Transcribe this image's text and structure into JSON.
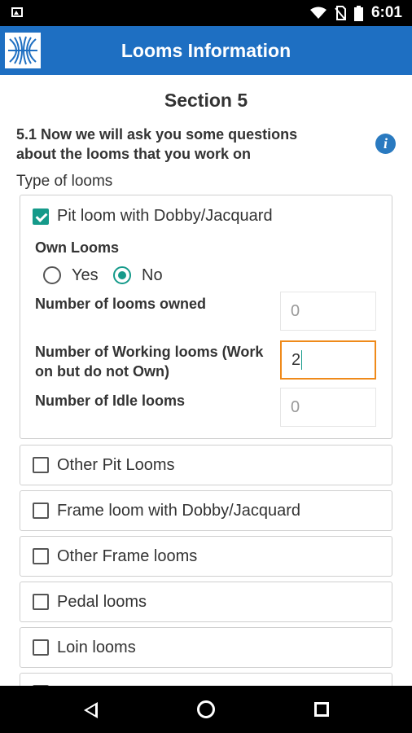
{
  "status_bar": {
    "time": "6:01"
  },
  "app_bar": {
    "title": "Looms Information"
  },
  "section": {
    "title": "Section 5",
    "question": "5.1 Now we will ask you some questions about the looms that you work on",
    "type_label": "Type of looms"
  },
  "looms": [
    {
      "label": "Pit loom with Dobby/Jacquard",
      "checked": true,
      "own_looms_label": "Own Looms",
      "own_options": [
        "Yes",
        "No"
      ],
      "own_selected": "No",
      "fields": [
        {
          "label": "Number of looms owned",
          "value": "0",
          "state": "disabled"
        },
        {
          "label": "Number of Working looms (Work on but do not Own)",
          "value": "2",
          "state": "focused"
        },
        {
          "label": "Number of Idle looms",
          "value": "0",
          "state": "disabled"
        }
      ]
    },
    {
      "label": "Other Pit Looms",
      "checked": false
    },
    {
      "label": "Frame loom with Dobby/Jacquard",
      "checked": false
    },
    {
      "label": "Other Frame looms",
      "checked": false
    },
    {
      "label": "Pedal looms",
      "checked": false
    },
    {
      "label": "Loin looms",
      "checked": false
    }
  ],
  "icons": {
    "app_logo": "loom-logo-icon",
    "info": "info-icon",
    "nav": [
      "back-icon",
      "home-icon",
      "recents-icon"
    ]
  },
  "colors": {
    "app_bar": "#1e6fc2",
    "accent": "#159a8a",
    "focus_border": "#ef8a1a",
    "info": "#2a7ac0"
  }
}
